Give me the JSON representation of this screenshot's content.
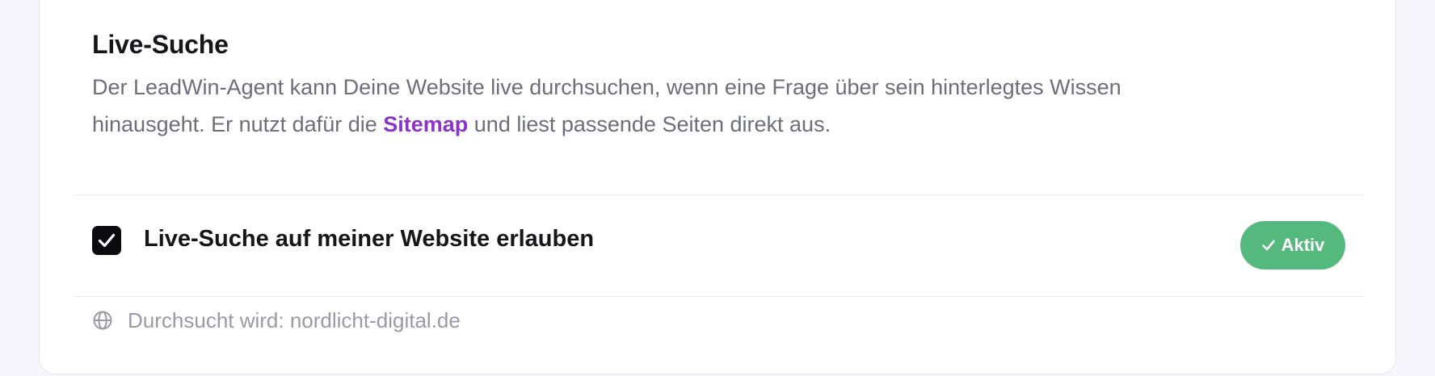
{
  "section": {
    "title": "Live-Suche",
    "description_before": "Der LeadWin-Agent kann Deine Website live durchsuchen, wenn eine Frage über sein hinterlegtes Wissen hinausgeht. Er nutzt dafür die ",
    "description_link": "Sitemap",
    "description_after": " und liest passende Seiten direkt aus."
  },
  "toggle": {
    "label": "Live-Suche auf meiner Website erlauben",
    "checked": true,
    "icon": "checkmark-icon"
  },
  "status": {
    "label": "Aktiv",
    "icon": "check-icon",
    "color": "#55b97d"
  },
  "footer": {
    "icon": "globe-icon",
    "text": "Durchsucht wird: nordlicht-digital.de"
  },
  "colors": {
    "link": "#8b34c9",
    "checkbox": "#0b0b0f",
    "card": "#ffffff",
    "page": "#f6f5fc"
  }
}
